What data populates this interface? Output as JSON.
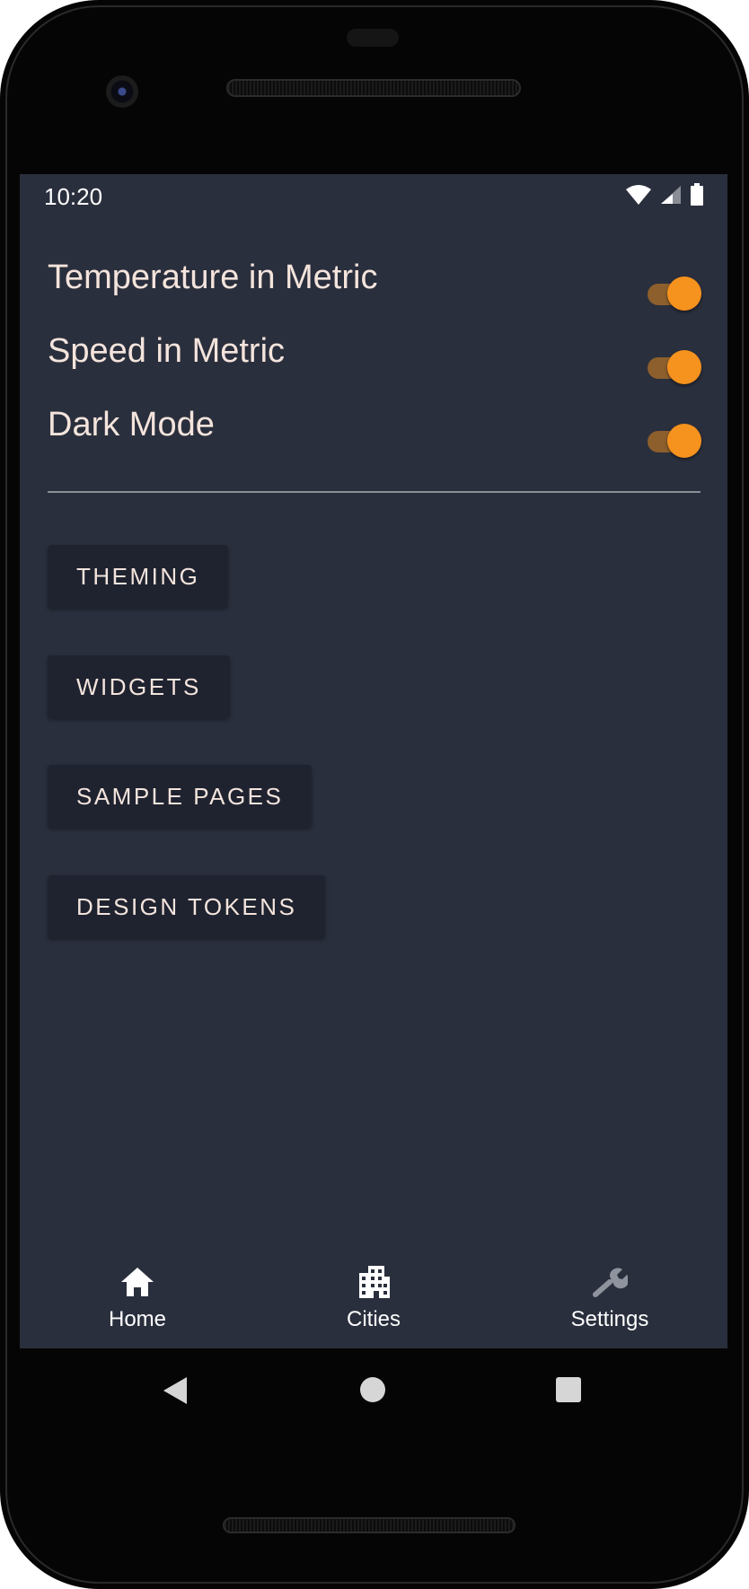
{
  "status_bar": {
    "time": "10:20"
  },
  "settings": [
    {
      "label": "Temperature in Metric",
      "enabled": true
    },
    {
      "label": "Speed in Metric",
      "enabled": true
    },
    {
      "label": "Dark Mode",
      "enabled": true
    }
  ],
  "buttons": [
    {
      "label": "THEMING"
    },
    {
      "label": "WIDGETS"
    },
    {
      "label": "SAMPLE PAGES"
    },
    {
      "label": "DESIGN TOKENS"
    }
  ],
  "bottom_nav": [
    {
      "label": "Home",
      "icon": "home-icon"
    },
    {
      "label": "Cities",
      "icon": "building-icon"
    },
    {
      "label": "Settings",
      "icon": "wrench-icon"
    }
  ],
  "system_nav": {
    "back_icon": "back-triangle-icon",
    "home_icon": "home-circle-icon",
    "recents_icon": "recents-square-icon"
  },
  "colors": {
    "background": "#2a2f3d",
    "button_background": "#1f2330",
    "text": "#f4e4dc",
    "accent": "#f6921e",
    "switch_track": "#8c5f2c"
  }
}
